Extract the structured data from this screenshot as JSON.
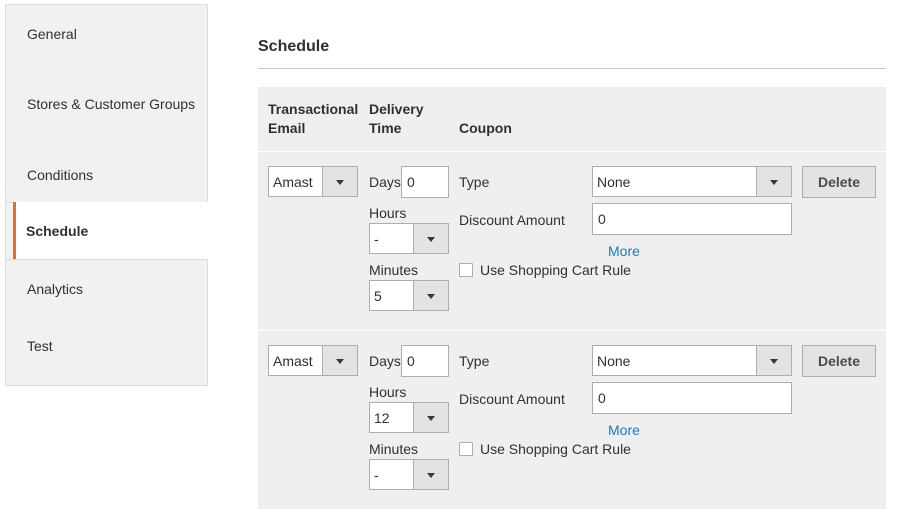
{
  "sidebar": {
    "items": [
      {
        "label": "General"
      },
      {
        "label": "Stores & Customer Groups"
      },
      {
        "label": "Conditions"
      },
      {
        "label": "Schedule"
      },
      {
        "label": "Analytics"
      },
      {
        "label": "Test"
      }
    ],
    "active": "Schedule"
  },
  "section": {
    "title": "Schedule"
  },
  "table": {
    "headers": {
      "email": "Transactional Email",
      "delivery": "Delivery Time",
      "coupon": "Coupon"
    },
    "rows": [
      {
        "email": "Amast",
        "days_label": "Days",
        "days": "0",
        "hours_label": "Hours",
        "hours": "-",
        "minutes_label": "Minutes",
        "minutes": "5",
        "type_label": "Type",
        "type": "None",
        "discount_label": "Discount Amount",
        "discount": "0",
        "more": "More",
        "cart_rule_label": "Use Shopping Cart Rule",
        "delete": "Delete"
      },
      {
        "email": "Amast",
        "days_label": "Days",
        "days": "0",
        "hours_label": "Hours",
        "hours": "12",
        "minutes_label": "Minutes",
        "minutes": "-",
        "type_label": "Type",
        "type": "None",
        "discount_label": "Discount Amount",
        "discount": "0",
        "more": "More",
        "cart_rule_label": "Use Shopping Cart Rule",
        "delete": "Delete"
      }
    ]
  },
  "colors": {
    "accent": "#e36b2c",
    "link": "#1979c3"
  }
}
